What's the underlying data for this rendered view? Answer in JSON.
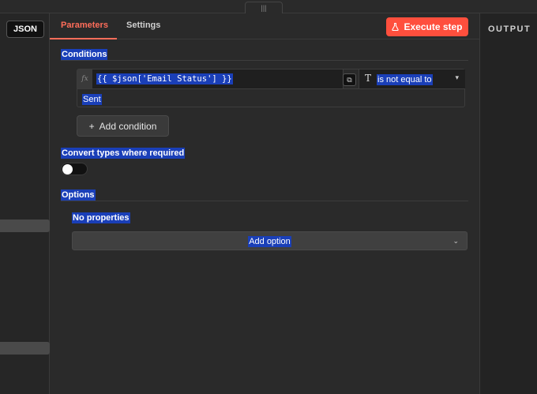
{
  "left": {
    "json_label": "JSON"
  },
  "drag": {
    "handle_glyph": "|||"
  },
  "tabs": [
    {
      "label": "Parameters"
    },
    {
      "label": "Settings"
    }
  ],
  "execute": {
    "label": "Execute step"
  },
  "conditions": {
    "title": "Conditions",
    "fx_label": "fx",
    "expression": "{{ $json['Email Status'] }}",
    "copy_glyph": "⧉",
    "type_icon": "T",
    "operator": "is not equal to",
    "value": "Sent",
    "add_label": "Add condition",
    "add_glyph": "+"
  },
  "convert": {
    "label": "Convert types where required",
    "enabled": false
  },
  "options": {
    "title": "Options",
    "empty_text": "No properties",
    "add_label": "Add option"
  },
  "output": {
    "title": "OUTPUT"
  },
  "colors": {
    "accent": "#ff6d5a",
    "execute_bg": "#ff4f3d",
    "selection": "#1a3fb8"
  }
}
